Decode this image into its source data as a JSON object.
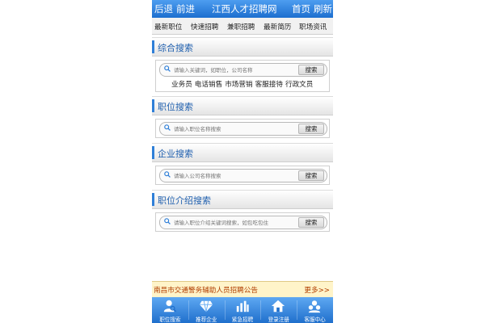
{
  "header": {
    "back_label": "后退",
    "forward_label": "前进",
    "title": "江西人才招聘网",
    "home_label": "首页",
    "refresh_label": "刷新"
  },
  "nav": {
    "items": [
      "最新职位",
      "快速招聘",
      "兼职招聘",
      "最新简历",
      "职场资讯"
    ]
  },
  "sections": {
    "general": {
      "title": "综合搜索",
      "placeholder": "请输入关键词，如职位，公司名称",
      "button": "搜索",
      "keywords": [
        "业务员",
        "电话销售",
        "市场营销",
        "客服接待",
        "行政文员"
      ]
    },
    "job": {
      "title": "职位搜索",
      "placeholder": "请输入职位名称搜索",
      "button": "搜索"
    },
    "company": {
      "title": "企业搜索",
      "placeholder": "请输入公司名称搜索",
      "button": "搜索"
    },
    "job_intro": {
      "title": "职位介绍搜索",
      "placeholder": "请输入职位介绍关键词搜索，如包吃包住",
      "button": "搜索"
    }
  },
  "notice": {
    "text": "南昌市交通警务辅助人员招聘公告",
    "more": "更多>>"
  },
  "tabbar": {
    "items": [
      {
        "label": "职位搜索",
        "icon": "person-search-icon"
      },
      {
        "label": "推荐企业",
        "icon": "diamond-icon"
      },
      {
        "label": "紧急招聘",
        "icon": "bar-chart-icon"
      },
      {
        "label": "登录注册",
        "icon": "home-icon"
      },
      {
        "label": "客服中心",
        "icon": "customer-service-icon"
      }
    ]
  },
  "colors": {
    "primary": "#1d6fcf",
    "section_title": "#1f5fae",
    "notice_text": "#b03d00",
    "notice_bg": "#fff4c9"
  }
}
